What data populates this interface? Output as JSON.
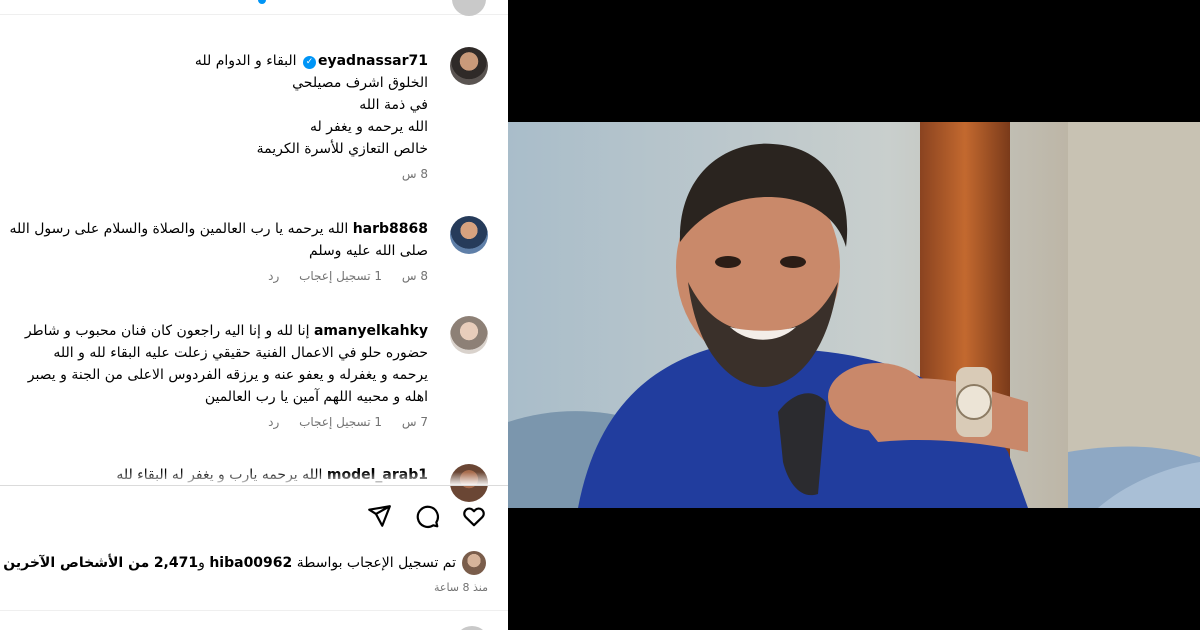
{
  "comments": [
    {
      "username": "eyadnassar71",
      "verified": true,
      "lines": [
        "البقاء و الدوام لله",
        "الخلوق اشرف مصيلحي",
        "في ذمة الله",
        "الله يرحمه و يغفر له",
        "خالص التعازي للأسرة الكريمة"
      ],
      "time": "8 س"
    },
    {
      "username": "harb8868",
      "lines": [
        "الله يرحمه يا رب العالمين والصلاة والسلام على رسول الله",
        "صلى الله عليه وسلم"
      ],
      "time": "8 س",
      "likes": "1 تسجيل إعجاب",
      "reply": "رد"
    },
    {
      "username": "amanyelkahky",
      "lines": [
        "إنا لله و إنا اليه راجعون كان فنان محبوب و شاطر",
        "حضوره حلو في الاعمال الفنية حقيقي زعلت عليه البقاء لله و الله",
        "يرحمه و يغفرله و يعفو عنه و يرزقه الفردوس الاعلى من الجنة و يصبر",
        "اهله و محبيه اللهم آمين يا رب العالمين"
      ],
      "time": "7 س",
      "likes": "1 تسجيل إعجاب",
      "reply": "رد"
    },
    {
      "username": "model_arab1",
      "lines": [
        "الله يرحمه يارب و يغفر له البقاء لله"
      ]
    }
  ],
  "verified_icon": "verified-check-icon",
  "likes_summary": {
    "prefix": "تم تسجيل الإعجاب بواسطة",
    "user": "hiba00962",
    "connector": "و",
    "count": "2,471",
    "suffix": "من الأشخاص الآخرين"
  },
  "post_time": "منذ 8 ساعة",
  "actions": [
    "heart-icon",
    "comment-icon",
    "share-icon"
  ],
  "colors": {
    "link_blue": "#0095f6",
    "muted_text": "#737373",
    "divider": "#dbdbdb"
  }
}
